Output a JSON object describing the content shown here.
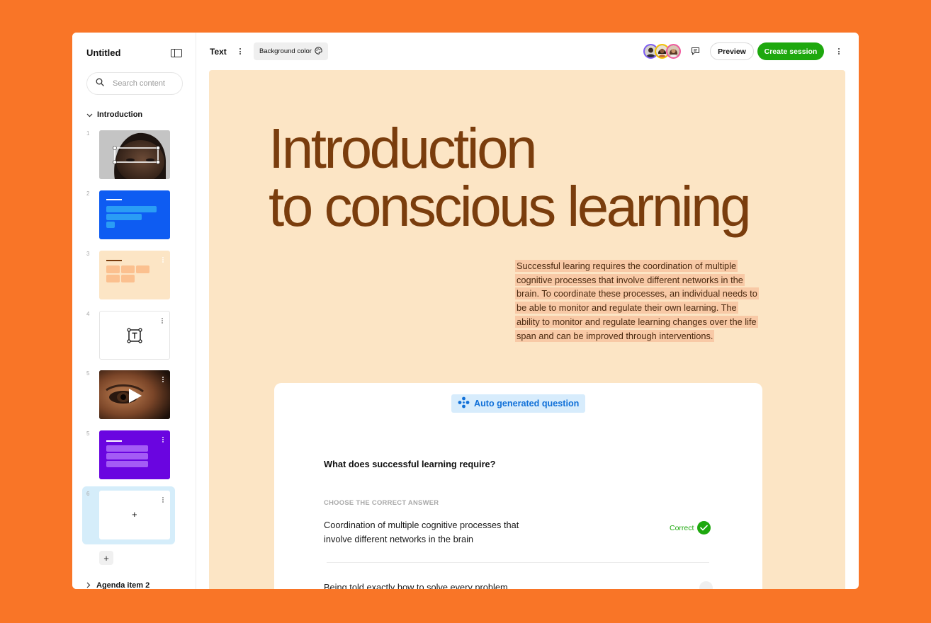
{
  "sidebar": {
    "doc_title": "Untitled",
    "search_placeholder": "Search content",
    "section_label": "Introduction",
    "slide_numbers": [
      "1",
      "2",
      "3",
      "4",
      "5",
      "5",
      "6"
    ],
    "add_slide_label": "+",
    "agenda_label": "Agenda item 2"
  },
  "topbar": {
    "block_type_label": "Text",
    "background_color_label": "Background color",
    "preview_label": "Preview",
    "create_session_label": "Create session"
  },
  "canvas": {
    "headline_line1": "Introduction",
    "headline_line2": "to conscious learning",
    "body_text": "Successful learing requires the coordination of multiple cognitive processes that involve different networks in the brain. To coordinate these processes, an individual needs to be able to monitor and regulate their own learning. The ability to monitor and regulate learning changes over the life span and can be improved through interventions."
  },
  "question_card": {
    "badge_label": "Auto generated question",
    "question": "What does successful learning require?",
    "instruction": "CHOOSE THE CORRECT ANSWER",
    "answer1": "Coordination of multiple cognitive processes that involve different networks in the brain",
    "answer1_status": "Correct",
    "answer2": "Being told exactly how to solve every problem"
  },
  "colors": {
    "page_background": "#F97527",
    "canvas_background": "#FCE5C5",
    "headline": "#7A3D0D",
    "primary_green": "#1EA80E",
    "auto_badge_bg": "#D7ECFC",
    "auto_badge_text": "#1070D8",
    "selected_slide_bg": "#D5EDFA"
  },
  "icons": [
    "panel-toggle-icon",
    "search-icon",
    "chevron-down-icon",
    "chevron-right-icon",
    "palette-icon",
    "comment-icon",
    "more-vertical-icon",
    "sparkle-icon",
    "check-icon",
    "play-icon",
    "text-box-icon"
  ]
}
